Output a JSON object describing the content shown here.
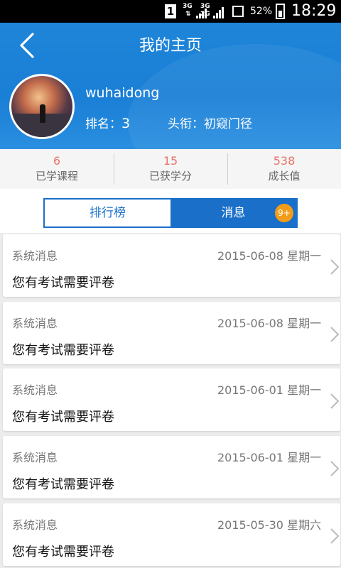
{
  "status_bar": {
    "sim": "1",
    "net1": "3G",
    "net2": "3G",
    "net2b": "2G",
    "battery": "52%",
    "time": "18:29"
  },
  "header": {
    "title": "我的主页",
    "username": "wuhaidong",
    "rank_label": "排名：",
    "rank_value": "3",
    "title_label": "头衔：初窥门径"
  },
  "stats": [
    {
      "value": "6",
      "label": "已学课程"
    },
    {
      "value": "15",
      "label": "已获学分"
    },
    {
      "value": "538",
      "label": "成长值"
    }
  ],
  "tabs": [
    {
      "label": "排行榜"
    },
    {
      "label": "消息",
      "badge": "9+"
    }
  ],
  "messages": [
    {
      "type": "系统消息",
      "date": "2015-06-08  星期一",
      "body": "您有考试需要评卷"
    },
    {
      "type": "系统消息",
      "date": "2015-06-08  星期一",
      "body": "您有考试需要评卷"
    },
    {
      "type": "系统消息",
      "date": "2015-06-01  星期一",
      "body": "您有考试需要评卷"
    },
    {
      "type": "系统消息",
      "date": "2015-06-01  星期一",
      "body": "您有考试需要评卷"
    },
    {
      "type": "系统消息",
      "date": "2015-05-30  星期六",
      "body": "您有考试需要评卷"
    }
  ],
  "colors": {
    "primary": "#1a6fc9",
    "header_bg": "#1e85d8",
    "stat_value": "#e8736a",
    "badge": "#f39c1a"
  }
}
